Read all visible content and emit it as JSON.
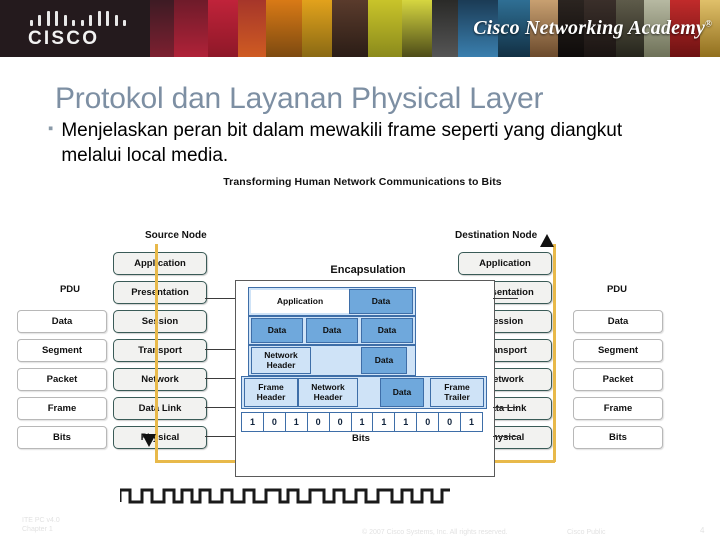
{
  "banner": {
    "logo_word": "CISCO",
    "logo_icon": "cisco-bridge-icon",
    "academy_text": "Cisco Networking Academy",
    "trademark": "®"
  },
  "slide": {
    "title": "Protokol dan Layanan Physical Layer",
    "bullet_marker": "▪",
    "bullet_text": "Menjelaskan peran bit dalam mewakili frame seperti yang diangkut melalui local media."
  },
  "diagram": {
    "title": "Transforming Human Network Communications to Bits",
    "source_node_label": "Source Node",
    "destination_node_label": "Destination Node",
    "pdu_header_left": "PDU",
    "pdu_header_right": "PDU",
    "pdu_items": [
      "Data",
      "Segment",
      "Packet",
      "Frame",
      "Bits"
    ],
    "osi_layers": [
      "Application",
      "Presentation",
      "Session",
      "Transport",
      "Network",
      "Data Link",
      "Physical"
    ],
    "encapsulation": {
      "title": "Encapsulation",
      "row_application": [
        "Application",
        "Data"
      ],
      "row_segments": [
        "Data",
        "Data",
        "Data"
      ],
      "row_packet": [
        "Network Header",
        "Data"
      ],
      "row_frame": [
        "Frame Header",
        "Network Header",
        "Data",
        "Frame Trailer"
      ],
      "bits": [
        "1",
        "0",
        "1",
        "0",
        "0",
        "1",
        "1",
        "1",
        "0",
        "0",
        "1"
      ],
      "bits_caption": "Bits"
    }
  },
  "footer": {
    "course": "ITE PC v4.0",
    "chapter": "Chapter 1",
    "copyright": "© 2007 Cisco Systems, Inc. All rights reserved.",
    "confidentiality": "Cisco Public",
    "page_number": "4"
  },
  "colors": {
    "title": "#7d8fa3",
    "flow_line": "#e8b94a",
    "layer_border": "#3a5b57",
    "encap_fill": "#cfe3f7",
    "encap_data": "#6fa8dc",
    "banner_bg": "#1c1417"
  }
}
